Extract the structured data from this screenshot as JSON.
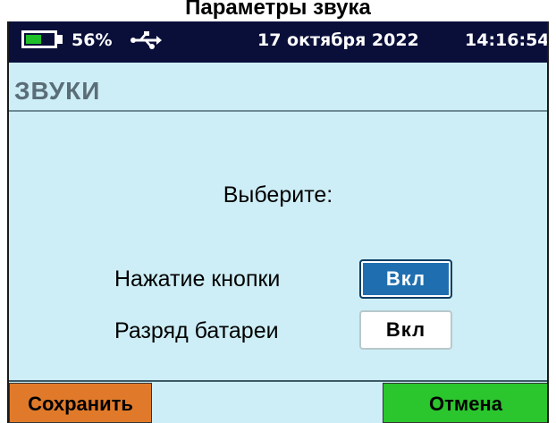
{
  "caption": "Параметры звука",
  "status_bar": {
    "battery_percent_text": "56%",
    "battery_level": 0.56,
    "usb_icon": "usb-icon",
    "date": "17 октября 2022",
    "time": "14:16:54"
  },
  "screen": {
    "title": "ЗВУКИ",
    "prompt": "Выберите:",
    "settings": [
      {
        "label": "Нажатие кнопки",
        "value": "Вкл",
        "selected": true
      },
      {
        "label": "Разряд батареи",
        "value": "Вкл",
        "selected": false
      }
    ]
  },
  "softkeys": {
    "save_label": "Сохранить",
    "cancel_label": "Отмена"
  },
  "colors": {
    "background": "#cdeef6",
    "status_bar": "#0a0f3a",
    "battery": "#1fbf2a",
    "save": "#e07a2a",
    "cancel": "#2bc52e",
    "selected": "#1f6fb0"
  }
}
